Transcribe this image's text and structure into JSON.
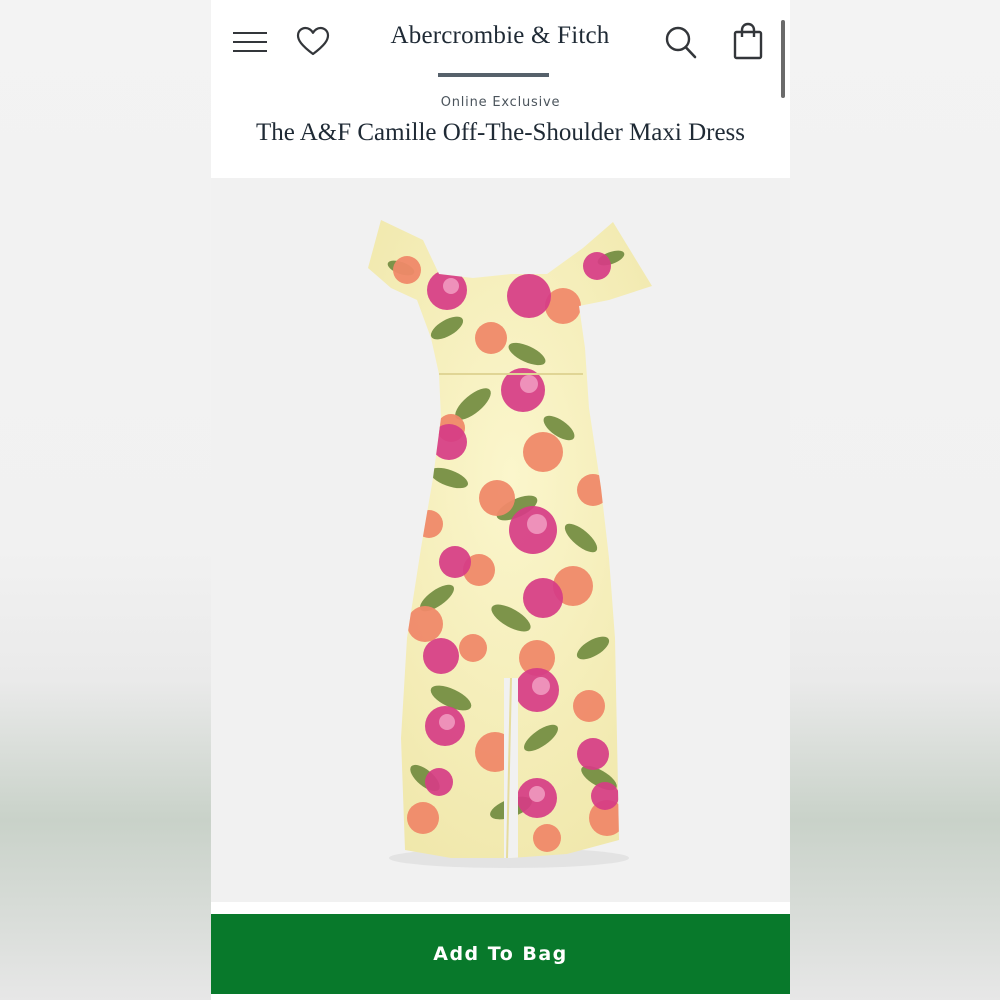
{
  "header": {
    "brand": "Abercrombie & Fitch",
    "icons": [
      "menu-icon",
      "heart-icon",
      "search-icon",
      "shopping-bag-icon"
    ]
  },
  "product": {
    "badge": "Online Exclusive",
    "title": "The A&F Camille Off-The-Shoulder Maxi Dress",
    "image_description_colors": {
      "fabric": "#f6efb8",
      "magenta": "#d63c86",
      "coral": "#f08a6a",
      "leaf": "#6f8a3e"
    }
  },
  "actions": {
    "add_to_bag": "Add To Bag",
    "button_color": "#08792b"
  }
}
